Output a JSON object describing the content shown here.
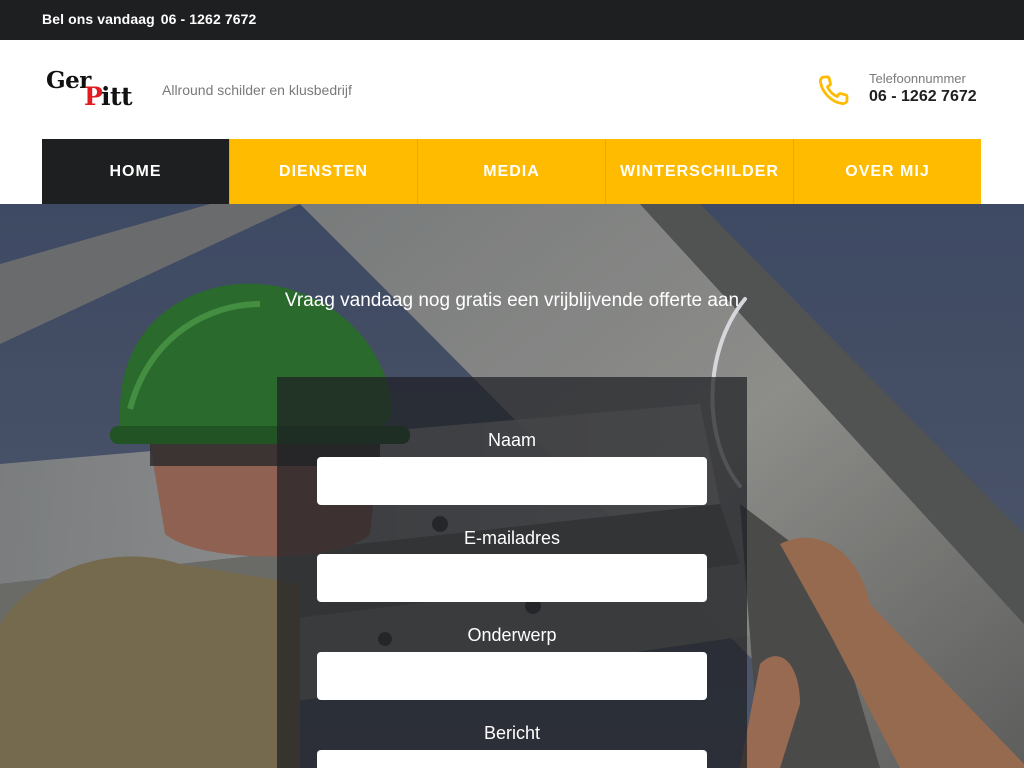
{
  "topbar": {
    "call_label": "Bel ons vandaag",
    "phone": "06 - 1262 7672"
  },
  "header": {
    "logo": {
      "part1": "Ger",
      "part2_letter": "P",
      "part2_rest": "itt"
    },
    "tagline": "Allround schilder en klusbedrijf",
    "phone_label": "Telefoonnummer",
    "phone_number": "06 - 1262 7672"
  },
  "nav": {
    "items": [
      {
        "label": "HOME",
        "active": true
      },
      {
        "label": "DIENSTEN",
        "active": false
      },
      {
        "label": "MEDIA",
        "active": false
      },
      {
        "label": "WINTERSCHILDER",
        "active": false
      },
      {
        "label": "OVER MIJ",
        "active": false
      }
    ]
  },
  "hero": {
    "title": "Vraag vandaag nog gratis een vrijblijvende offerte aan"
  },
  "form": {
    "fields": [
      {
        "label": "Naam",
        "value": ""
      },
      {
        "label": "E-mailadres",
        "value": ""
      },
      {
        "label": "Onderwerp",
        "value": ""
      },
      {
        "label": "Bericht",
        "value": ""
      }
    ]
  },
  "colors": {
    "accent": "#ffbb00",
    "dark": "#1e1f21",
    "logo_red": "#e11b22"
  },
  "icons": {
    "phone": "phone-icon"
  }
}
